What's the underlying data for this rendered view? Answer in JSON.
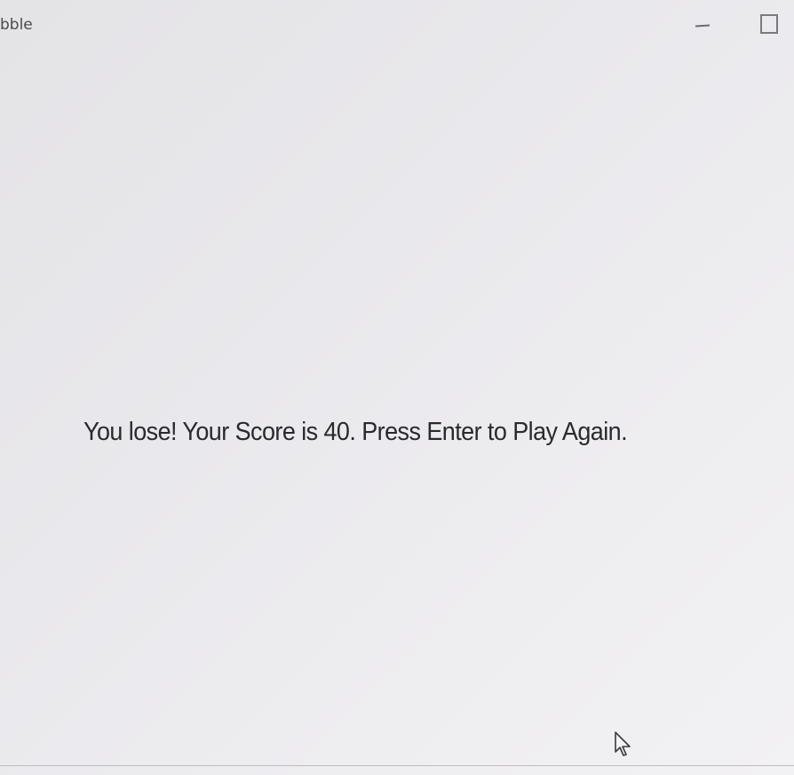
{
  "window": {
    "title": "bble"
  },
  "controls": {
    "minimize_icon": "minimize-icon",
    "maximize_icon": "maximize-icon"
  },
  "game": {
    "message": "You lose! Your Score is 40. Press Enter to Play Again."
  },
  "pointer": {
    "icon": "mouse-cursor-icon"
  }
}
